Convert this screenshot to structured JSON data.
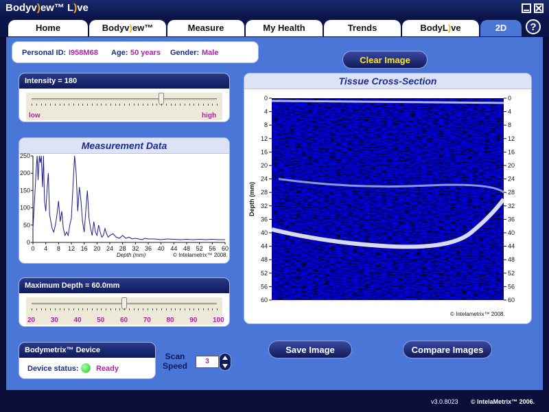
{
  "app": {
    "brand_prefix": "Bodyv",
    "brand_eye": ")",
    "brand_mid": "ew™ L",
    "brand_eye2": ")",
    "brand_suffix": "ve"
  },
  "tabs": [
    {
      "label": "Home"
    },
    {
      "label_a": "Bodyv",
      "label_eye": ")",
      "label_b": "ew™"
    },
    {
      "label": "Measure"
    },
    {
      "label": "My Health"
    },
    {
      "label": "Trends"
    },
    {
      "label_a": "BodyL",
      "label_eye": ")",
      "label_b": "ve"
    },
    {
      "label": "2D"
    }
  ],
  "help_label": "?",
  "info": {
    "pid_label": "Personal ID:",
    "pid_value": "I958M68",
    "age_label": "Age:",
    "age_value": "50 years",
    "gender_label": "Gender:",
    "gender_value": "Male"
  },
  "clear_button": "Clear Image",
  "intensity": {
    "title": "Intensity = 180",
    "low": "low",
    "high": "high",
    "fraction": 0.7
  },
  "measurement": {
    "title": "Measurement Data",
    "xlabel": "Depth (mm)",
    "copyright": "© Intelametrix™ 2008."
  },
  "chart_data": {
    "type": "line",
    "title": "Measurement Data",
    "xlabel": "Depth (mm)",
    "ylabel": "",
    "xlim": [
      0,
      60
    ],
    "ylim": [
      0,
      250
    ],
    "x_ticks": [
      0,
      4,
      8,
      12,
      16,
      20,
      24,
      28,
      32,
      36,
      40,
      44,
      48,
      52,
      56,
      60
    ],
    "y_ticks": [
      0,
      50,
      100,
      150,
      200,
      250
    ],
    "series": [
      {
        "x": [
          0,
          0.5,
          1,
          1.3,
          1.6,
          2,
          2.3,
          2.6,
          3,
          3.3,
          3.6,
          4,
          4.4,
          4.8,
          5.2,
          5.6,
          6,
          6.5,
          7,
          7.5,
          8,
          8.5,
          9,
          9.5,
          10,
          10.5,
          11,
          11.5,
          12,
          12.5,
          13,
          13.5,
          14,
          14.5,
          15,
          15.5,
          16,
          16.5,
          17,
          17.5,
          18,
          18.5,
          19,
          19.5,
          20,
          20.5,
          21,
          21.5,
          22,
          22.5,
          23,
          23.5,
          24,
          25,
          26,
          27,
          28,
          29,
          30,
          31,
          32,
          33,
          34,
          35,
          36,
          38,
          40,
          42,
          44,
          46,
          48,
          50,
          52,
          54,
          56,
          58,
          60
        ],
        "values": [
          40,
          120,
          210,
          250,
          180,
          250,
          230,
          250,
          160,
          250,
          120,
          90,
          150,
          200,
          80,
          60,
          40,
          30,
          50,
          80,
          120,
          60,
          90,
          40,
          20,
          30,
          20,
          50,
          70,
          160,
          250,
          200,
          90,
          160,
          120,
          60,
          30,
          90,
          150,
          70,
          40,
          20,
          60,
          30,
          20,
          50,
          30,
          15,
          20,
          40,
          25,
          15,
          20,
          25,
          15,
          12,
          20,
          12,
          15,
          10,
          12,
          10,
          8,
          12,
          10,
          10,
          8,
          10,
          9,
          8,
          9,
          8,
          9,
          8,
          9,
          8,
          8
        ]
      }
    ]
  },
  "tissue": {
    "title": "Tissue Cross-Section",
    "ylabel": "Depth (mm)",
    "ticks": [
      0,
      4,
      8,
      12,
      16,
      20,
      24,
      28,
      32,
      36,
      40,
      44,
      48,
      52,
      56,
      60
    ],
    "copyright": "© Intelametrix™ 2008."
  },
  "max_depth": {
    "title": "Maximum Depth = 60.0mm",
    "ticks": [
      "20",
      "30",
      "40",
      "50",
      "60",
      "70",
      "80",
      "90",
      "100"
    ],
    "fraction": 0.5
  },
  "device": {
    "title": "Bodymetrix™ Device",
    "status_label": "Device status:",
    "status_value": "Ready",
    "status_color": "#22c422"
  },
  "scan_speed": {
    "label": "Scan Speed",
    "value": "3"
  },
  "save_button": "Save Image",
  "compare_button": "Compare Images",
  "footer": {
    "version": "v3.0.8023",
    "copyright": "© IntelaMetrix™ 2006."
  }
}
